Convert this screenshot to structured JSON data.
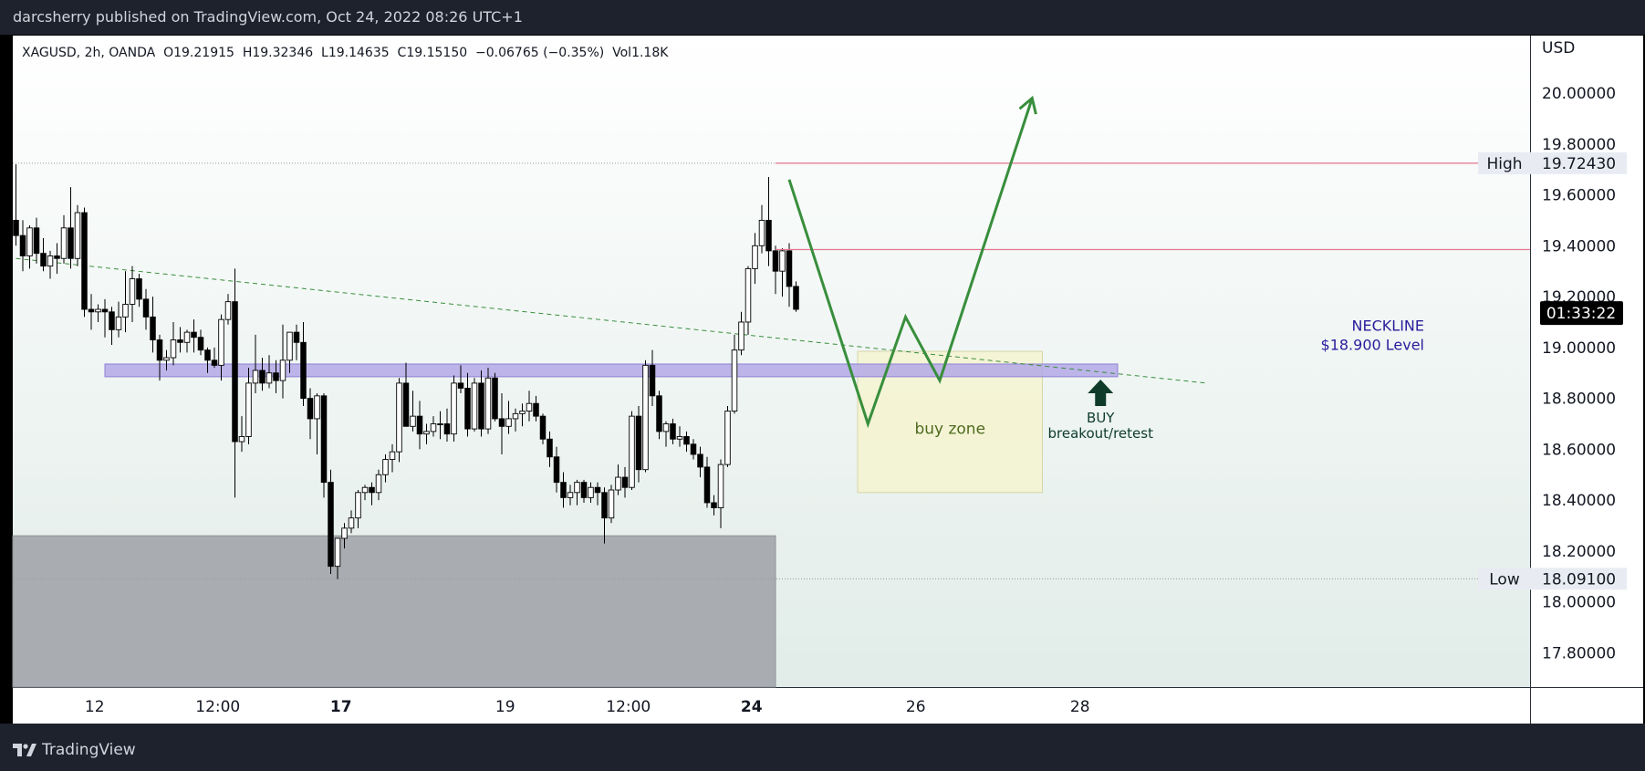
{
  "header": {
    "publisher": "darcsherry published on TradingView.com, Oct 24, 2022 08:26 UTC+1"
  },
  "legend": {
    "text": "XAGUSD, 2h, OANDA  O19.21915  H19.32346  L19.14635  C19.15150  −0.06765 (−0.35%)  Vol1.18K"
  },
  "footer": {
    "brand": "TradingView"
  },
  "colors": {
    "bull": "#ffffff",
    "bear": "#000000",
    "neckline": "#b4a8e6",
    "projection": "#388e3c",
    "buyzone": "#f4f3d0",
    "supportzone": "#a9acb0",
    "highline": "#e57592"
  },
  "chart_data": {
    "type": "candlestick",
    "symbol": "XAGUSD",
    "timeframe": "2h",
    "currency": "USD",
    "ylim": [
      17.65,
      20.25
    ],
    "y_ticks": [
      "20.00000",
      "19.80000",
      "19.60000",
      "19.40000",
      "19.20000",
      "19.00000",
      "18.80000",
      "18.60000",
      "18.40000",
      "18.20000",
      "18.00000",
      "17.80000"
    ],
    "x_ticks": [
      {
        "bar": 11.5,
        "label": "12",
        "bold": false
      },
      {
        "bar": 29.5,
        "label": "12:00",
        "bold": false
      },
      {
        "bar": 47.5,
        "label": "17",
        "bold": true
      },
      {
        "bar": 71.5,
        "label": "19",
        "bold": false
      },
      {
        "bar": 89.5,
        "label": "12:00",
        "bold": false
      },
      {
        "bar": 107.5,
        "label": "24",
        "bold": true
      },
      {
        "bar": 131.5,
        "label": "26",
        "bold": false
      },
      {
        "bar": 155.5,
        "label": "28",
        "bold": false
      }
    ],
    "candles": [
      [
        19.5,
        19.72,
        19.4,
        19.44
      ],
      [
        19.44,
        19.5,
        19.3,
        19.36
      ],
      [
        19.36,
        19.48,
        19.31,
        19.47
      ],
      [
        19.47,
        19.51,
        19.33,
        19.37
      ],
      [
        19.37,
        19.43,
        19.3,
        19.32
      ],
      [
        19.32,
        19.38,
        19.27,
        19.36
      ],
      [
        19.36,
        19.41,
        19.29,
        19.35
      ],
      [
        19.35,
        19.52,
        19.33,
        19.47
      ],
      [
        19.47,
        19.63,
        19.31,
        19.35
      ],
      [
        19.35,
        19.56,
        19.32,
        19.53
      ],
      [
        19.53,
        19.55,
        19.12,
        19.15
      ],
      [
        19.15,
        19.21,
        19.07,
        19.14
      ],
      [
        19.14,
        19.17,
        19.1,
        19.15
      ],
      [
        19.15,
        19.19,
        19.04,
        19.14
      ],
      [
        19.14,
        19.16,
        19.01,
        19.07
      ],
      [
        19.07,
        19.18,
        19.04,
        19.12
      ],
      [
        19.12,
        19.3,
        19.06,
        19.17
      ],
      [
        19.17,
        19.32,
        19.1,
        19.27
      ],
      [
        19.27,
        19.29,
        19.16,
        19.19
      ],
      [
        19.19,
        19.23,
        19.07,
        19.12
      ],
      [
        19.12,
        19.2,
        18.98,
        19.03
      ],
      [
        19.03,
        19.05,
        18.87,
        18.95
      ],
      [
        18.95,
        18.99,
        18.91,
        18.96
      ],
      [
        18.96,
        19.1,
        18.93,
        19.03
      ],
      [
        19.03,
        19.08,
        18.98,
        19.02
      ],
      [
        19.02,
        19.07,
        18.98,
        19.06
      ],
      [
        19.06,
        19.11,
        18.98,
        19.04
      ],
      [
        19.04,
        19.07,
        18.97,
        18.99
      ],
      [
        18.99,
        19.0,
        18.9,
        18.95
      ],
      [
        18.95,
        19.0,
        18.92,
        18.93
      ],
      [
        18.93,
        19.13,
        18.87,
        19.11
      ],
      [
        19.11,
        19.21,
        19.09,
        19.18
      ],
      [
        19.18,
        19.31,
        18.41,
        18.63
      ],
      [
        18.63,
        18.73,
        18.59,
        18.65
      ],
      [
        18.65,
        18.92,
        18.62,
        18.86
      ],
      [
        18.86,
        19.05,
        18.82,
        18.91
      ],
      [
        18.91,
        18.96,
        18.83,
        18.86
      ],
      [
        18.86,
        18.97,
        18.84,
        18.9
      ],
      [
        18.9,
        18.95,
        18.82,
        18.87
      ],
      [
        18.87,
        19.09,
        18.8,
        18.95
      ],
      [
        18.95,
        19.05,
        18.9,
        19.06
      ],
      [
        19.06,
        19.09,
        18.95,
        19.02
      ],
      [
        19.02,
        19.1,
        18.77,
        18.8
      ],
      [
        18.8,
        18.84,
        18.64,
        18.72
      ],
      [
        18.72,
        18.82,
        18.58,
        18.81
      ],
      [
        18.81,
        18.82,
        18.41,
        18.47
      ],
      [
        18.47,
        18.52,
        18.11,
        18.14
      ],
      [
        18.14,
        18.25,
        18.09,
        18.25
      ],
      [
        18.25,
        18.31,
        18.21,
        18.29
      ],
      [
        18.29,
        18.36,
        18.27,
        18.33
      ],
      [
        18.33,
        18.44,
        18.29,
        18.43
      ],
      [
        18.43,
        18.46,
        18.4,
        18.45
      ],
      [
        18.45,
        18.47,
        18.38,
        18.43
      ],
      [
        18.43,
        18.52,
        18.4,
        18.5
      ],
      [
        18.5,
        18.58,
        18.47,
        18.56
      ],
      [
        18.56,
        18.62,
        18.51,
        18.59
      ],
      [
        18.59,
        18.88,
        18.55,
        18.86
      ],
      [
        18.86,
        18.94,
        18.69,
        18.69
      ],
      [
        18.69,
        18.83,
        18.67,
        18.73
      ],
      [
        18.73,
        18.79,
        18.6,
        18.66
      ],
      [
        18.66,
        18.7,
        18.62,
        18.67
      ],
      [
        18.67,
        18.73,
        18.65,
        18.7
      ],
      [
        18.7,
        18.75,
        18.64,
        18.7
      ],
      [
        18.7,
        18.76,
        18.63,
        18.66
      ],
      [
        18.66,
        18.89,
        18.63,
        18.86
      ],
      [
        18.86,
        18.93,
        18.82,
        18.84
      ],
      [
        18.84,
        18.9,
        18.65,
        18.68
      ],
      [
        18.68,
        18.88,
        18.67,
        18.86
      ],
      [
        18.86,
        18.91,
        18.65,
        18.68
      ],
      [
        18.68,
        18.92,
        18.66,
        18.88
      ],
      [
        18.88,
        18.9,
        18.71,
        18.72
      ],
      [
        18.72,
        18.82,
        18.58,
        18.69
      ],
      [
        18.69,
        18.79,
        18.66,
        18.72
      ],
      [
        18.72,
        18.76,
        18.67,
        18.74
      ],
      [
        18.74,
        18.78,
        18.69,
        18.75
      ],
      [
        18.75,
        18.83,
        18.71,
        18.78
      ],
      [
        18.78,
        18.81,
        18.71,
        18.73
      ],
      [
        18.73,
        18.74,
        18.62,
        18.64
      ],
      [
        18.64,
        18.67,
        18.53,
        18.57
      ],
      [
        18.57,
        18.61,
        18.43,
        18.47
      ],
      [
        18.47,
        18.51,
        18.37,
        18.41
      ],
      [
        18.41,
        18.46,
        18.38,
        18.43
      ],
      [
        18.43,
        18.48,
        18.38,
        18.47
      ],
      [
        18.47,
        18.48,
        18.39,
        18.41
      ],
      [
        18.41,
        18.47,
        18.39,
        18.45
      ],
      [
        18.45,
        18.47,
        18.38,
        18.43
      ],
      [
        18.43,
        18.45,
        18.23,
        18.33
      ],
      [
        18.33,
        18.46,
        18.31,
        18.44
      ],
      [
        18.44,
        18.54,
        18.42,
        18.49
      ],
      [
        18.49,
        18.53,
        18.41,
        18.45
      ],
      [
        18.45,
        18.75,
        18.44,
        18.73
      ],
      [
        18.73,
        18.77,
        18.47,
        18.52
      ],
      [
        18.52,
        18.95,
        18.51,
        18.93
      ],
      [
        18.93,
        18.99,
        18.77,
        18.81
      ],
      [
        18.81,
        18.83,
        18.64,
        18.67
      ],
      [
        18.67,
        18.71,
        18.61,
        18.7
      ],
      [
        18.7,
        18.72,
        18.62,
        18.64
      ],
      [
        18.64,
        18.69,
        18.61,
        18.65
      ],
      [
        18.65,
        18.67,
        18.59,
        18.62
      ],
      [
        18.62,
        18.64,
        18.56,
        18.58
      ],
      [
        18.58,
        18.61,
        18.49,
        18.53
      ],
      [
        18.53,
        18.57,
        18.37,
        18.39
      ],
      [
        18.39,
        18.42,
        18.34,
        18.37
      ],
      [
        18.37,
        18.56,
        18.29,
        18.54
      ],
      [
        18.54,
        18.77,
        18.53,
        18.75
      ],
      [
        18.75,
        19.05,
        18.74,
        18.99
      ],
      [
        18.99,
        19.14,
        18.97,
        19.1
      ],
      [
        19.1,
        19.32,
        19.05,
        19.31
      ],
      [
        19.31,
        19.45,
        19.25,
        19.4
      ],
      [
        19.4,
        19.56,
        19.37,
        19.5
      ],
      [
        19.5,
        19.67,
        19.32,
        19.38
      ],
      [
        19.38,
        19.4,
        19.21,
        19.3
      ],
      [
        19.3,
        19.39,
        19.2,
        19.38
      ],
      [
        19.38,
        19.41,
        19.16,
        19.24
      ],
      [
        19.24,
        19.26,
        19.14,
        19.15
      ]
    ],
    "support_zone": {
      "from_bar": 0,
      "to_bar": 111,
      "y_top": 18.26,
      "y_bottom": 17.65
    },
    "neckline_zone": {
      "from_bar": 13,
      "to_bar": 161,
      "y_top": 18.935,
      "y_bottom": 18.885,
      "label": "NECKLINE",
      "sublabel": "$18.900 Level"
    },
    "dashed_trendline": {
      "points": [
        [
          0,
          19.35
        ],
        [
          174,
          18.86
        ]
      ]
    },
    "high_level": {
      "value": 19.7243,
      "label": "High",
      "price": "19.72430",
      "from_bar": 111
    },
    "low_level": {
      "value": 18.091,
      "label": "Low",
      "price": "18.09100"
    },
    "resistance_line": {
      "value": 19.385,
      "from_bar": 111
    },
    "buy_zone": {
      "from_bar": 123,
      "to_bar": 150,
      "y_top": 18.985,
      "y_bottom": 18.43,
      "label": "buy zone"
    },
    "projection_path": [
      [
        113,
        19.66
      ],
      [
        124.5,
        18.7
      ],
      [
        130,
        19.12
      ],
      [
        135,
        18.87
      ],
      [
        148.5,
        19.98
      ]
    ],
    "buy_arrow": {
      "bar": 158.5,
      "value": 18.82,
      "label": "BUY",
      "sublabel": "breakout/retest"
    },
    "countdown": "01:33:22",
    "countdown_value": 19.2
  }
}
